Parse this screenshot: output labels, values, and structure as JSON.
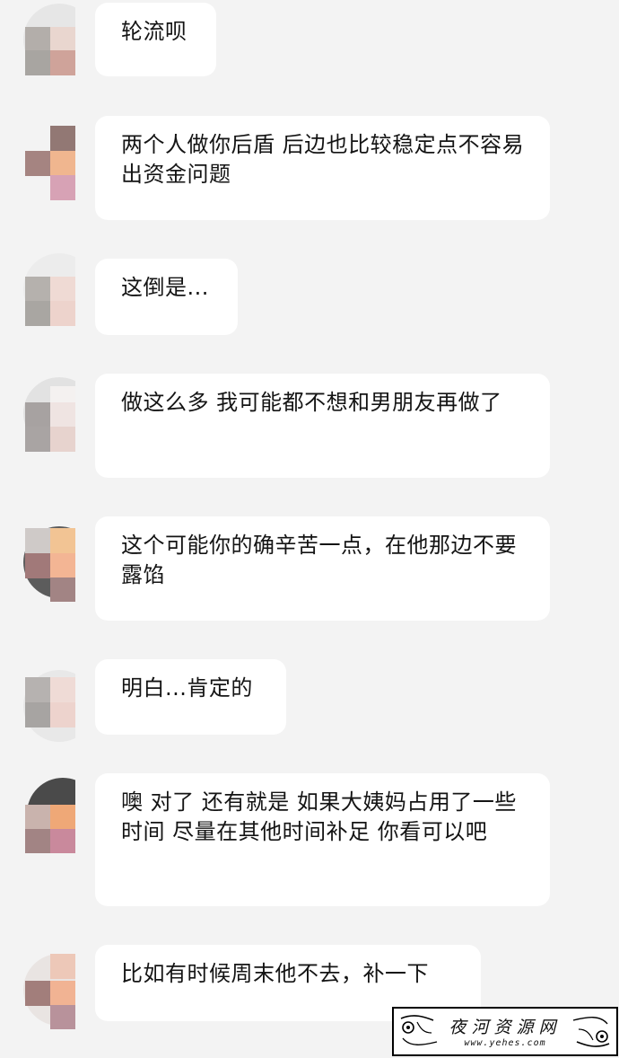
{
  "messages": [
    {
      "text": "轮流呗"
    },
    {
      "text": "两个人做你后盾 后边也比较稳定点不容易出资金问题"
    },
    {
      "text": "这倒是..."
    },
    {
      "text": "做这么多 我可能都不想和男朋友再做了"
    },
    {
      "text": "这个可能你的确辛苦一点，在他那边不要露馅"
    },
    {
      "text": "明白...肯定的"
    },
    {
      "text": "噢 对了 还有就是 如果大姨妈占用了一些时间 尽量在其他时间补足 你看可以吧"
    },
    {
      "text": "比如有时候周末他不去，补一下"
    }
  ],
  "watermark": {
    "title": "夜河资源网",
    "url": "www.yehes.com"
  }
}
